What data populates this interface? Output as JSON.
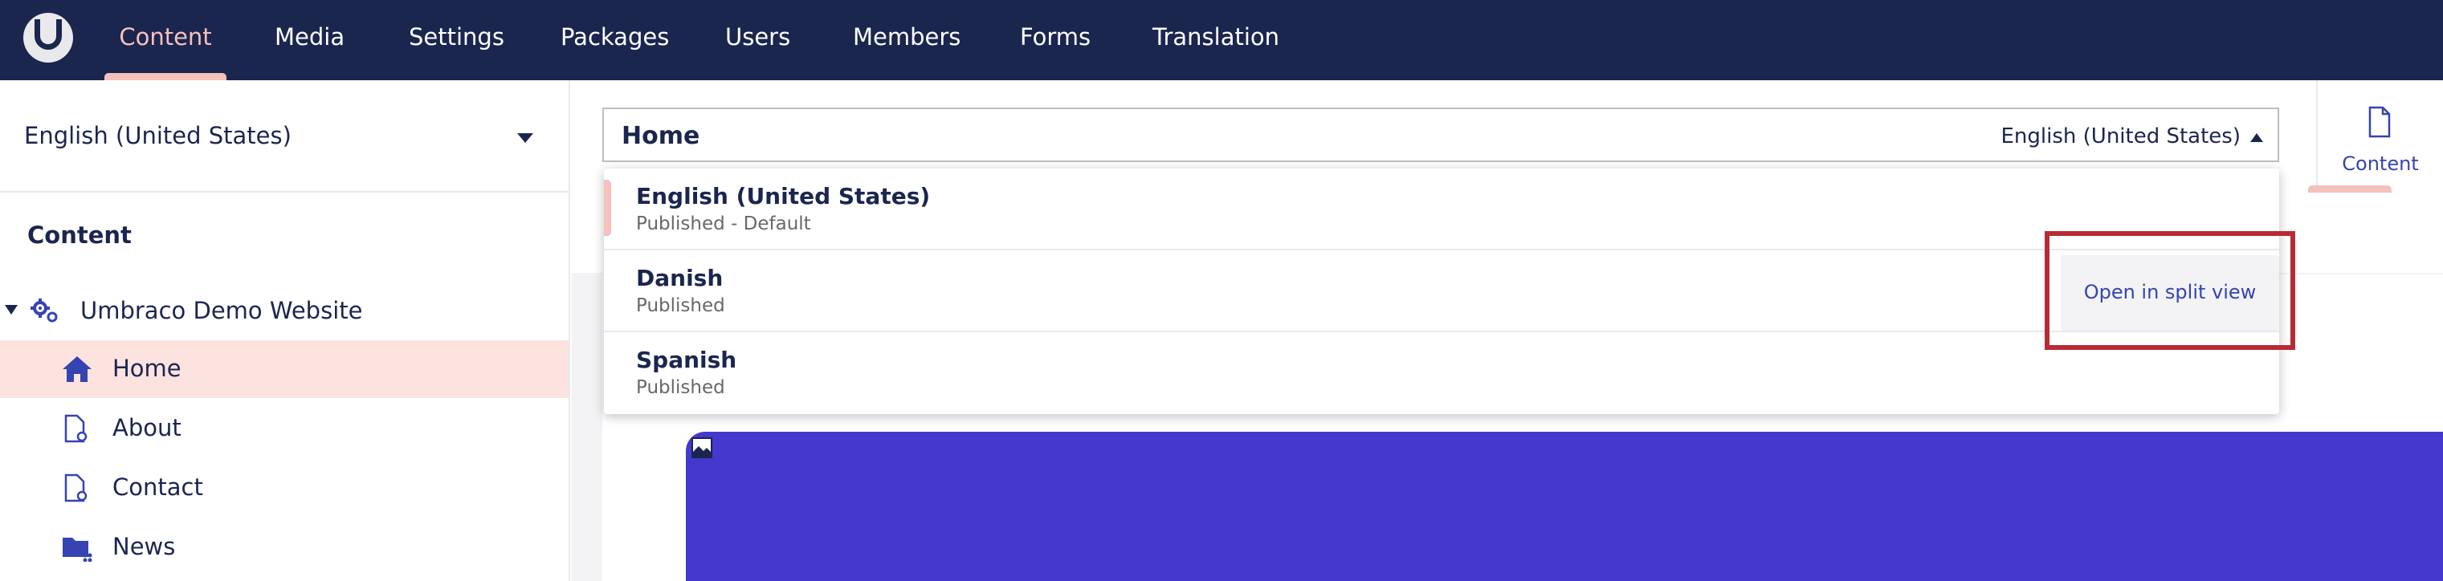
{
  "topnav": {
    "items": [
      {
        "label": "Content",
        "active": true
      },
      {
        "label": "Media",
        "active": false
      },
      {
        "label": "Settings",
        "active": false
      },
      {
        "label": "Packages",
        "active": false
      },
      {
        "label": "Users",
        "active": false
      },
      {
        "label": "Members",
        "active": false
      },
      {
        "label": "Forms",
        "active": false
      },
      {
        "label": "Translation",
        "active": false
      }
    ]
  },
  "sidebar": {
    "language": "English (United States)",
    "section_title": "Content",
    "tree": [
      {
        "label": "Umbraco Demo Website",
        "icon": "gears-icon",
        "selected": false
      },
      {
        "label": "Home",
        "icon": "home-icon",
        "selected": true
      },
      {
        "label": "About",
        "icon": "document-icon",
        "selected": false
      },
      {
        "label": "Contact",
        "icon": "document-icon",
        "selected": false
      },
      {
        "label": "News",
        "icon": "folder-icon",
        "selected": false
      }
    ]
  },
  "editor": {
    "name": "Home",
    "current_variant": "English (United States)",
    "apps": [
      {
        "label": "Content",
        "icon": "document-icon",
        "active": true
      }
    ]
  },
  "variant_dropdown": {
    "open": true,
    "items": [
      {
        "name": "English (United States)",
        "state": "Published - Default",
        "current": true
      },
      {
        "name": "Danish",
        "state": "Published",
        "current": false
      },
      {
        "name": "Spanish",
        "state": "Published",
        "current": false
      }
    ],
    "split_view_label": "Open in split view"
  },
  "colors": {
    "nav_bg": "#1b264f",
    "accent_pink": "#f5c1bc",
    "selected_row": "#fde3e0",
    "link_blue": "#3544b1",
    "hero_purple": "#4538cc",
    "highlight_red": "#b72b35"
  }
}
